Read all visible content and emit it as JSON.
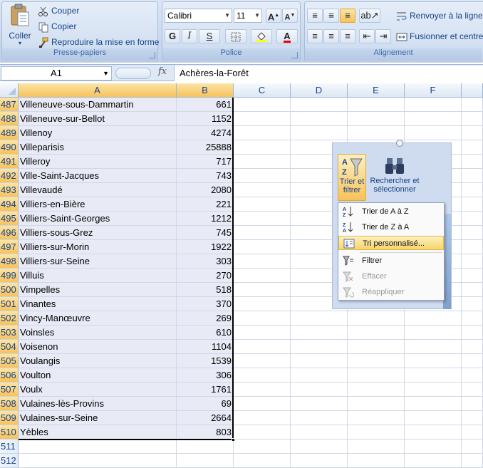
{
  "ribbon": {
    "clipboard": {
      "label": "Presse-papiers",
      "paste": "Coller",
      "cut": "Couper",
      "copy": "Copier",
      "format_painter": "Reproduire la mise en forme"
    },
    "font": {
      "label": "Police",
      "font_name": "Calibri",
      "font_size": "11",
      "grow": "A",
      "shrink": "A",
      "bold": "G",
      "italic": "I",
      "underline": "S",
      "font_color": "A"
    },
    "alignment": {
      "label": "Alignement",
      "wrap_text": "Renvoyer à la ligne a",
      "merge_center": "Fusionner et centre"
    }
  },
  "formula_bar": {
    "name_box": "A1",
    "fx": "fx",
    "content": "Achères-la-Forêt"
  },
  "grid": {
    "columns": [
      "A",
      "B",
      "C",
      "D",
      "E",
      "F"
    ],
    "rows": [
      {
        "n": "487",
        "a": "Villeneuve-sous-Dammartin",
        "b": "661"
      },
      {
        "n": "488",
        "a": "Villeneuve-sur-Bellot",
        "b": "1152"
      },
      {
        "n": "489",
        "a": "Villenoy",
        "b": "4274"
      },
      {
        "n": "490",
        "a": "Villeparisis",
        "b": "25888"
      },
      {
        "n": "491",
        "a": "Villeroy",
        "b": "717"
      },
      {
        "n": "492",
        "a": "Ville-Saint-Jacques",
        "b": "743"
      },
      {
        "n": "493",
        "a": "Villevaudé",
        "b": "2080"
      },
      {
        "n": "494",
        "a": "Villiers-en-Bière",
        "b": "221"
      },
      {
        "n": "495",
        "a": "Villiers-Saint-Georges",
        "b": "1212"
      },
      {
        "n": "496",
        "a": "Villiers-sous-Grez",
        "b": "745"
      },
      {
        "n": "497",
        "a": "Villiers-sur-Morin",
        "b": "1922"
      },
      {
        "n": "498",
        "a": "Villiers-sur-Seine",
        "b": "303"
      },
      {
        "n": "499",
        "a": "Villuis",
        "b": "270"
      },
      {
        "n": "500",
        "a": "Vimpelles",
        "b": "518"
      },
      {
        "n": "501",
        "a": "Vinantes",
        "b": "370"
      },
      {
        "n": "502",
        "a": "Vincy-Manœuvre",
        "b": "269"
      },
      {
        "n": "503",
        "a": "Voinsles",
        "b": "610"
      },
      {
        "n": "504",
        "a": "Voisenon",
        "b": "1104"
      },
      {
        "n": "505",
        "a": "Voulangis",
        "b": "1539"
      },
      {
        "n": "506",
        "a": "Voulton",
        "b": "306"
      },
      {
        "n": "507",
        "a": "Voulx",
        "b": "1761"
      },
      {
        "n": "508",
        "a": "Vulaines-lès-Provins",
        "b": "69"
      },
      {
        "n": "509",
        "a": "Vulaines-sur-Seine",
        "b": "2664"
      },
      {
        "n": "510",
        "a": "Yèbles",
        "b": "803"
      },
      {
        "n": "511",
        "a": "",
        "b": ""
      },
      {
        "n": "512",
        "a": "",
        "b": ""
      }
    ]
  },
  "sort_panel": {
    "sort_filter_line1": "Trier et",
    "sort_filter_line2": "filtrer",
    "find_select_line1": "Rechercher et",
    "find_select_line2": "sélectionner",
    "menu": [
      {
        "label": "Trier de A à Z",
        "state": "enabled"
      },
      {
        "label": "Trier de Z à A",
        "state": "enabled"
      },
      {
        "label": "Tri personnalisé...",
        "state": "highlighted"
      },
      {
        "label": "Filtrer",
        "state": "enabled"
      },
      {
        "label": "Effacer",
        "state": "disabled"
      },
      {
        "label": "Réappliquer",
        "state": "disabled"
      }
    ]
  }
}
